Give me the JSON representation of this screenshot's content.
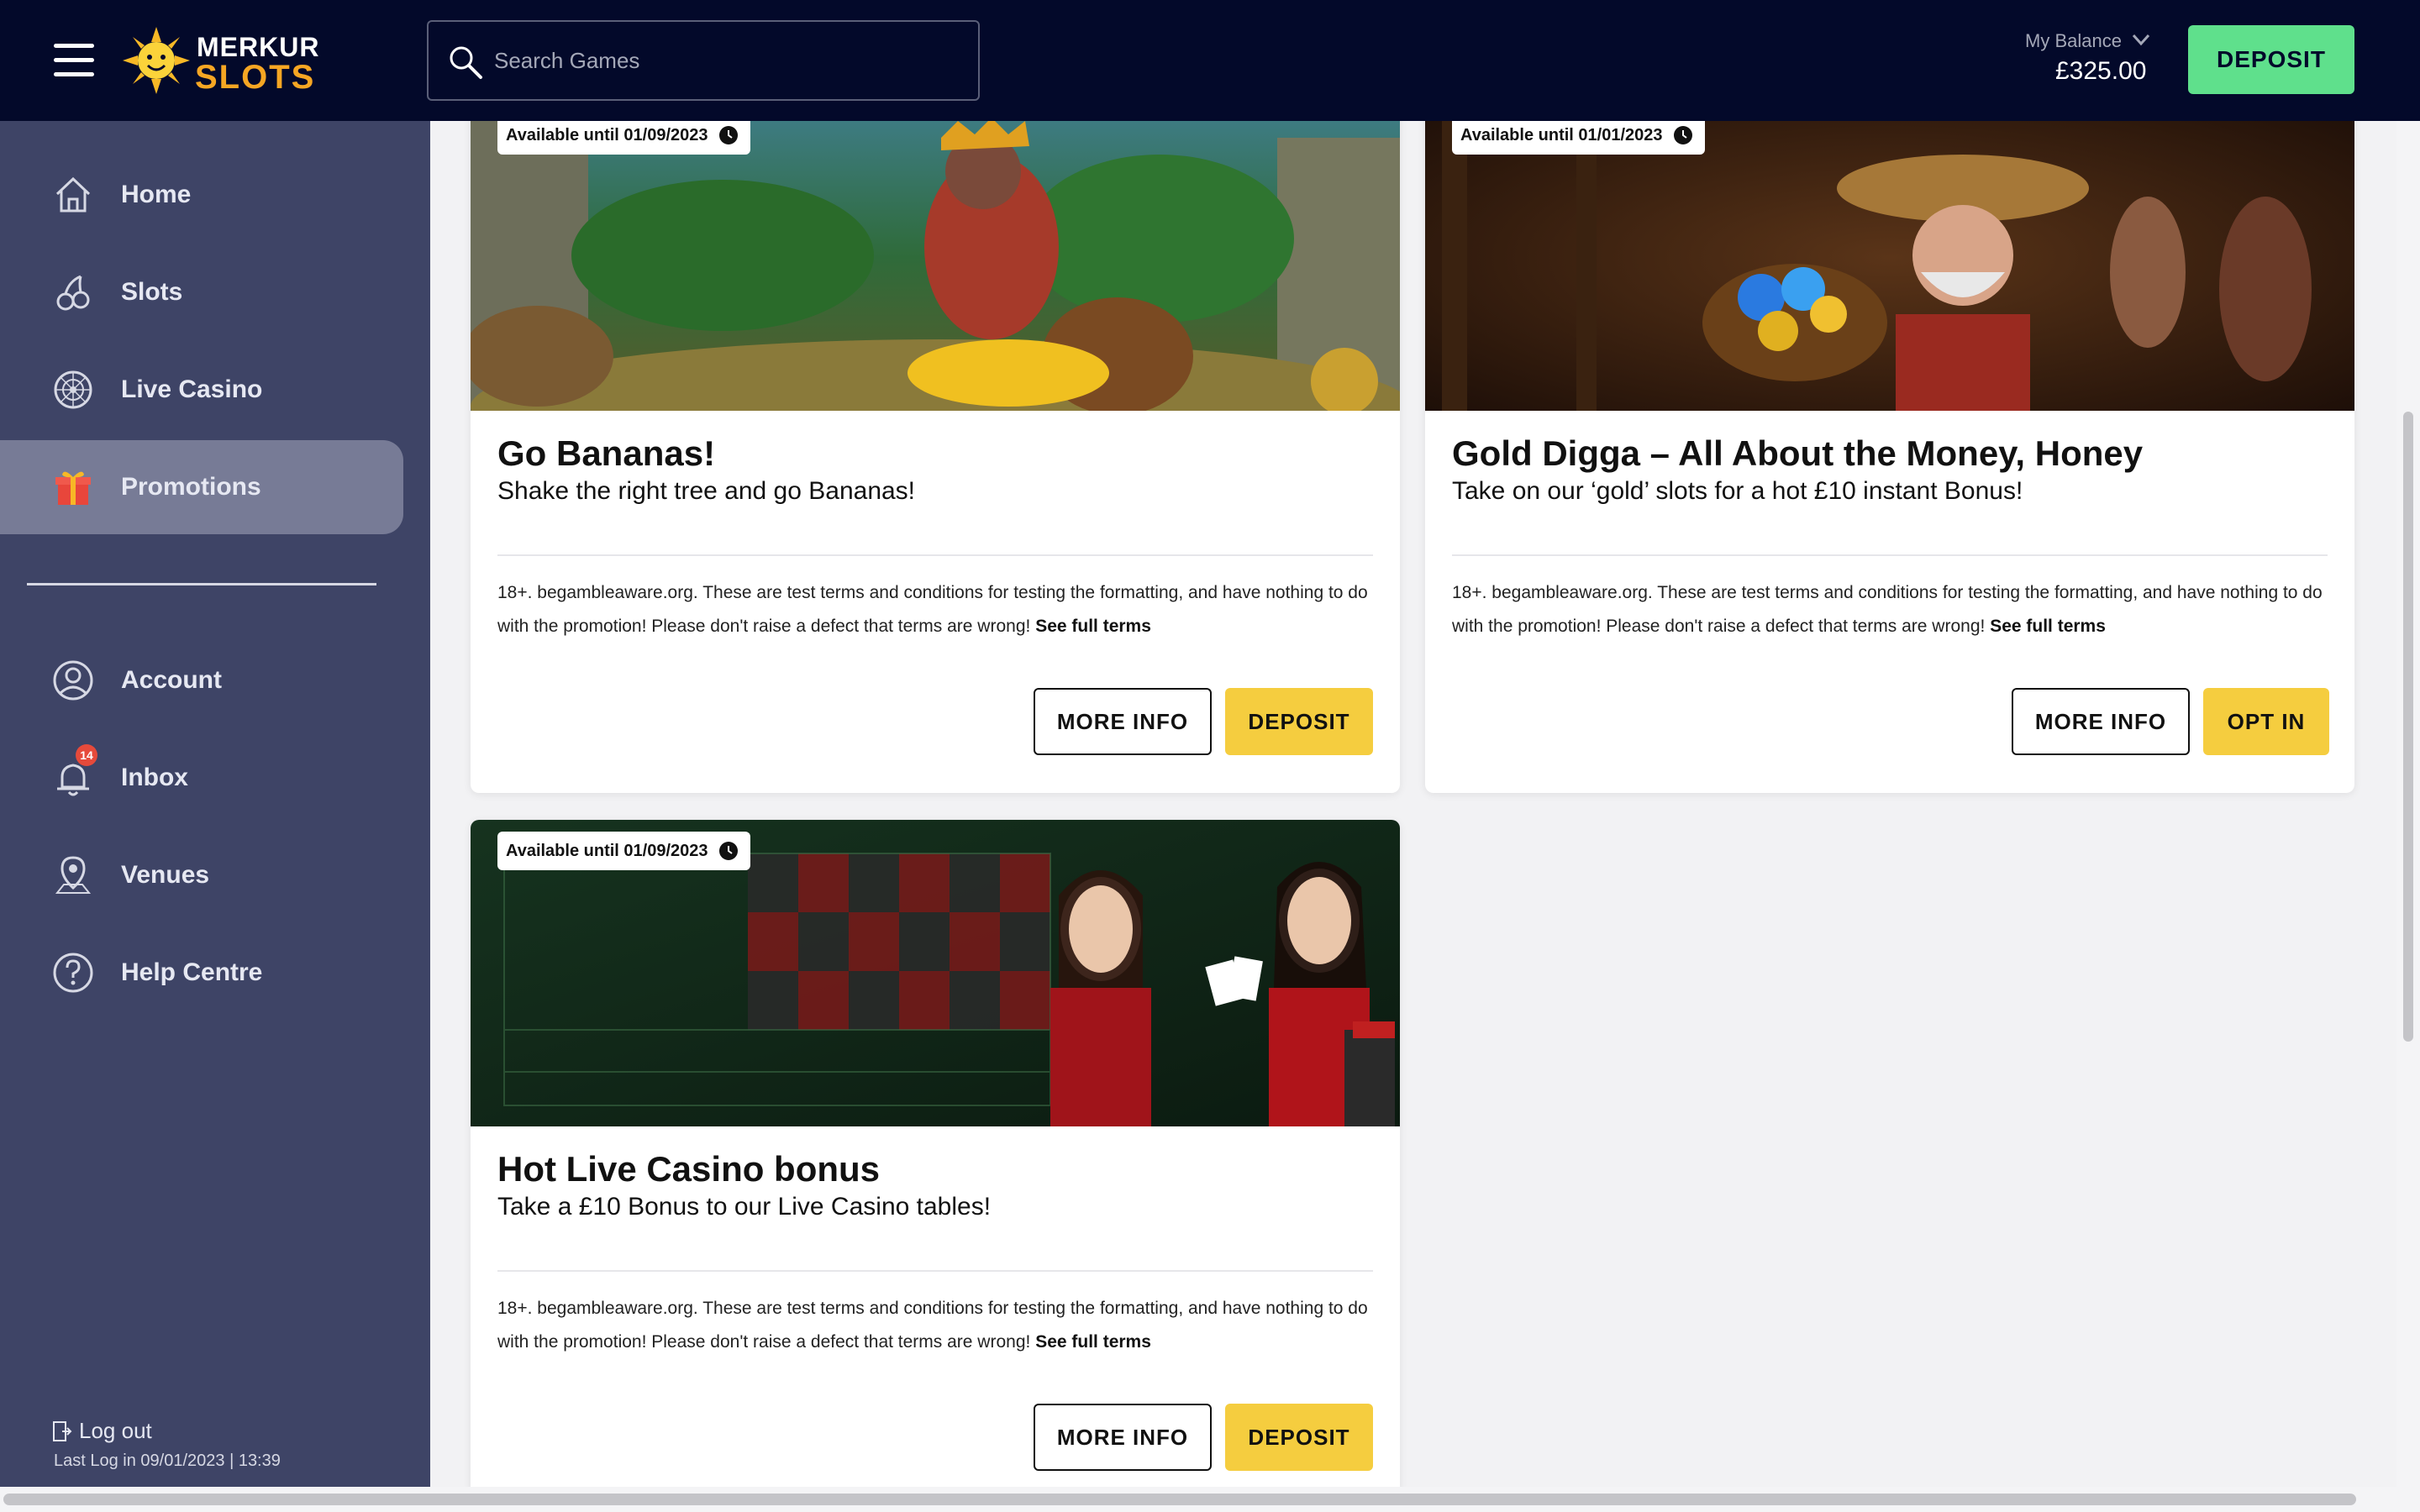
{
  "header": {
    "brand_top": "MERKUR",
    "brand_bottom": "SLOTS",
    "search_placeholder": "Search Games",
    "balance_label": "My Balance",
    "balance_value": "£325.00",
    "deposit_label": "DEPOSIT"
  },
  "sidebar": {
    "items": [
      {
        "label": "Home",
        "icon": "home-icon"
      },
      {
        "label": "Slots",
        "icon": "cherries-icon"
      },
      {
        "label": "Live Casino",
        "icon": "roulette-icon"
      },
      {
        "label": "Promotions",
        "icon": "gift-icon",
        "active": true
      },
      {
        "label": "Account",
        "icon": "user-icon"
      },
      {
        "label": "Inbox",
        "icon": "bell-icon",
        "badge": "14"
      },
      {
        "label": "Venues",
        "icon": "map-pin-icon"
      },
      {
        "label": "Help Centre",
        "icon": "help-icon"
      }
    ],
    "logout_label": "Log out",
    "last_login": "Last Log in 09/01/2023 | 13:39"
  },
  "promotions": [
    {
      "availability": "Available until 01/09/2023",
      "title": "Go Bananas!",
      "subtitle": "Shake the right tree and go Bananas!",
      "terms": "18+. begambleaware.org. These are test terms and conditions for testing the formatting, and have nothing to do with the promotion! Please don't raise a defect that terms are wrong!",
      "terms_link": "See full terms",
      "secondary_label": "MORE INFO",
      "primary_label": "DEPOSIT"
    },
    {
      "availability": "Available until 01/01/2023",
      "title": "Gold Digga – All About the Money, Honey",
      "subtitle": "Take on our ‘gold’ slots for a hot £10 instant Bonus!",
      "terms": "18+. begambleaware.org. These are test terms and conditions for testing the formatting, and have nothing to do with the promotion! Please don't raise a defect that terms are wrong!",
      "terms_link": "See full terms",
      "secondary_label": "MORE INFO",
      "primary_label": "OPT IN"
    },
    {
      "availability": "Available until 01/09/2023",
      "title": "Hot Live Casino bonus",
      "subtitle": "Take a £10 Bonus to our Live Casino tables!",
      "terms": "18+. begambleaware.org. These are test terms and conditions for testing the formatting, and have nothing to do with the promotion! Please don't raise a defect that terms are wrong!",
      "terms_link": "See full terms",
      "secondary_label": "MORE INFO",
      "primary_label": "DEPOSIT"
    }
  ],
  "colors": {
    "header_bg": "#03092a",
    "sidebar_bg": "#3e4466",
    "deposit_green": "#5fe08c",
    "cta_yellow": "#f5cd3f"
  }
}
